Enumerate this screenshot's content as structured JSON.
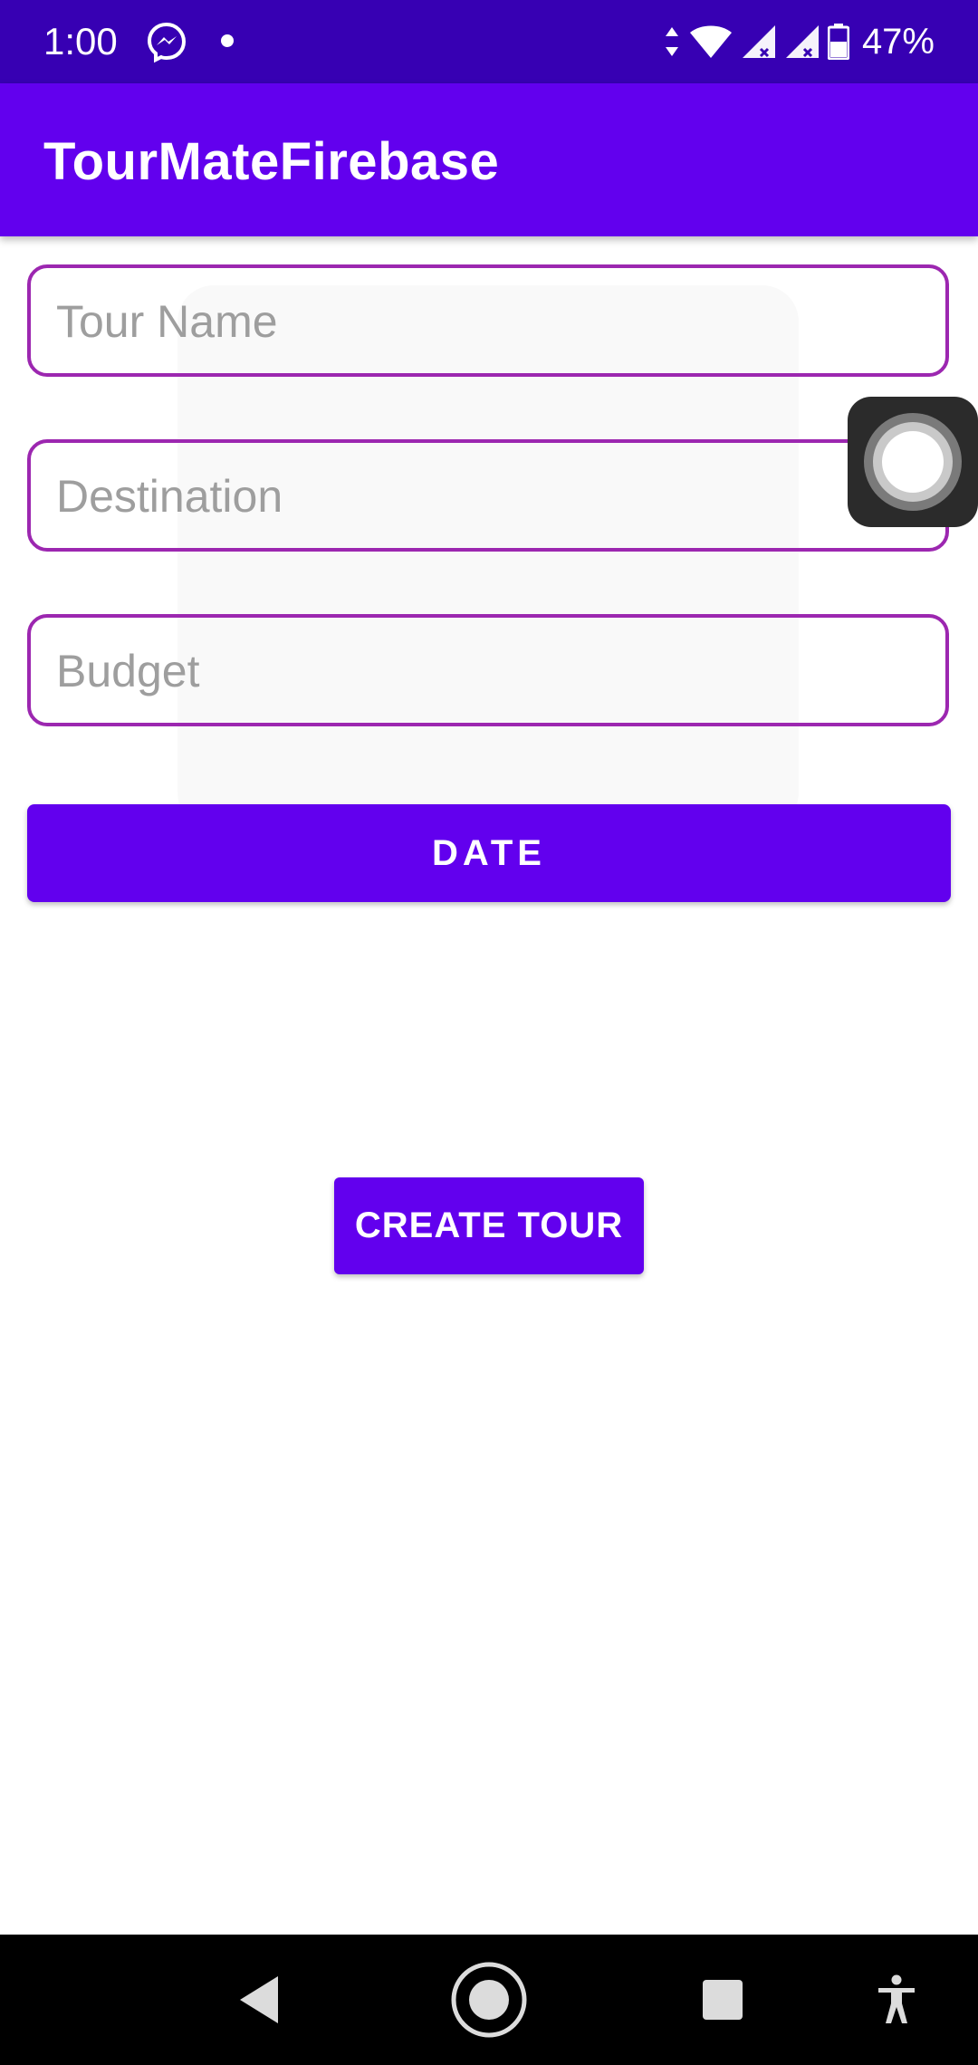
{
  "status_bar": {
    "time": "1:00",
    "battery_percent": "47%",
    "icons": [
      "messenger-icon",
      "notification-dot-icon",
      "data-arrows-icon",
      "wifi-icon",
      "signal-icon",
      "signal-icon",
      "battery-icon"
    ]
  },
  "app_bar": {
    "title": "TourMateFirebase"
  },
  "form": {
    "tour_name_placeholder": "Tour Name",
    "destination_placeholder": "Destination",
    "budget_placeholder": "Budget",
    "date_label": "DATE",
    "create_label": "CREATE TOUR"
  },
  "nav_bar": {
    "icons": [
      "back-icon",
      "home-icon",
      "recents-icon",
      "accessibility-icon"
    ]
  },
  "colors": {
    "status_bar": "#3700b3",
    "primary": "#6200ee",
    "field_border": "#9c27b0"
  }
}
